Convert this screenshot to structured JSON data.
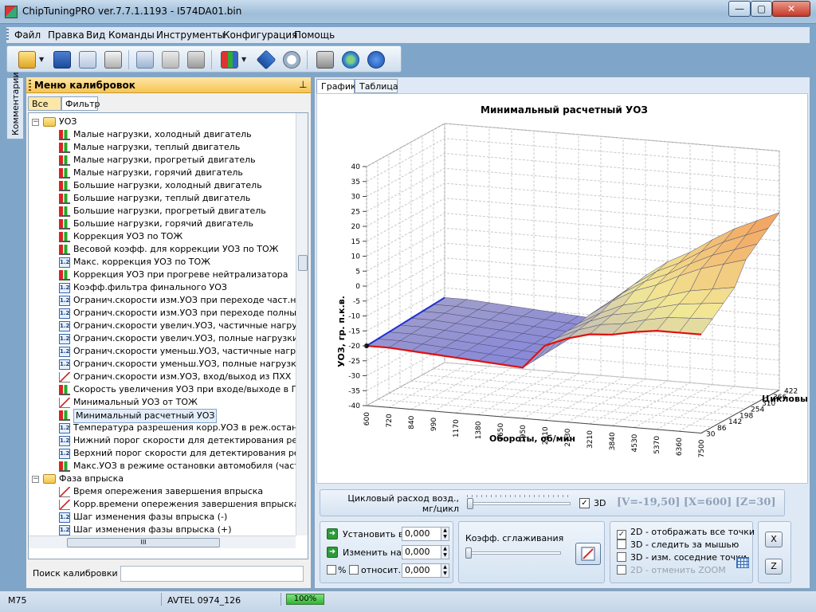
{
  "window": {
    "title": "ChipTuningPRO ver.7.7.1.1193 - I574DA01.bin",
    "buttons": {
      "minimize": "—",
      "maximize": "▢",
      "close": "✕"
    }
  },
  "menu": [
    "Файл",
    "Правка",
    "Вид",
    "Команды",
    "Инструменты",
    "Конфигурация",
    "Помощь"
  ],
  "toolbar": {
    "icons": [
      "open-folder-icon",
      "save-icon",
      "save-as-icon",
      "print-icon",
      "copy-icon",
      "paste-icon",
      "undo-icon",
      "compare-icon",
      "info-icon",
      "checksum-icon",
      "tools-icon",
      "web-update-icon",
      "help-icon"
    ]
  },
  "side_tab": {
    "label": "Комментарии"
  },
  "calibration_panel": {
    "title": "Меню калибровок",
    "pin": "⊥",
    "tabs": [
      "Все",
      "Фильтр"
    ],
    "search_label": "Поиск калибровки",
    "search_value": "",
    "hscroll_grip": "III"
  },
  "tree": [
    {
      "kind": "folder",
      "label": "УОЗ",
      "expander": "−"
    },
    {
      "kind": "chart",
      "label": "Малые нагрузки, холодный двигатель"
    },
    {
      "kind": "chart",
      "label": "Малые нагрузки, теплый двигатель"
    },
    {
      "kind": "chart",
      "label": "Малые нагрузки, прогретый двигатель"
    },
    {
      "kind": "chart",
      "label": "Малые нагрузки, горячий двигатель"
    },
    {
      "kind": "chart",
      "label": "Большие нагрузки, холодный двигатель"
    },
    {
      "kind": "chart",
      "label": "Большие нагрузки, теплый двигатель"
    },
    {
      "kind": "chart",
      "label": "Большие нагрузки, прогретый двигатель"
    },
    {
      "kind": "chart",
      "label": "Большие нагрузки, горячий двигатель"
    },
    {
      "kind": "chart",
      "label": "Коррекция УОЗ по ТОЖ"
    },
    {
      "kind": "chart",
      "label": "Весовой коэфф. для коррекции УОЗ по ТОЖ"
    },
    {
      "kind": "table",
      "label": "Макс. коррекция УОЗ по ТОЖ"
    },
    {
      "kind": "chart",
      "label": "Коррекция УОЗ при прогреве нейтрализатора"
    },
    {
      "kind": "table",
      "label": "Коэфф.фильтра финального УОЗ"
    },
    {
      "kind": "table",
      "label": "Огранич.скорости изм.УОЗ при переходе част.нагруз"
    },
    {
      "kind": "table",
      "label": "Огранич.скорости изм.УОЗ при переходе полные нагр"
    },
    {
      "kind": "table",
      "label": "Огранич.скорости увелич.УОЗ, частичные нагрузки"
    },
    {
      "kind": "table",
      "label": "Огранич.скорости увелич.УОЗ, полные нагрузки"
    },
    {
      "kind": "table",
      "label": "Огранич.скорости уменьш.УОЗ, частичные нагрузки"
    },
    {
      "kind": "table",
      "label": "Огранич.скорости уменьш.УОЗ, полные нагрузки"
    },
    {
      "kind": "curve",
      "label": "Огранич.скорости изм.УОЗ, вход/выход из ПХХ"
    },
    {
      "kind": "chart",
      "label": "Скорость увеличения УОЗ при входе/выходе в ПХХ"
    },
    {
      "kind": "curve",
      "label": "Минимальный УОЗ от ТОЖ"
    },
    {
      "kind": "chart",
      "label": "Минимальный расчетный УОЗ",
      "selected": true
    },
    {
      "kind": "table",
      "label": "Температура разрешения корр.УОЗ в реж.остановки а"
    },
    {
      "kind": "table",
      "label": "Нижний порог скорости для детектирования реж.оста"
    },
    {
      "kind": "table",
      "label": "Верхний порог скорости для детектирования реж.оста"
    },
    {
      "kind": "chart",
      "label": "Макс.УОЗ в режиме остановки автомобиля (част.и по."
    },
    {
      "kind": "folder",
      "label": "Фаза впрыска",
      "expander": "−"
    },
    {
      "kind": "curve",
      "label": "Время опережения завершения впрыска"
    },
    {
      "kind": "curve",
      "label": "Корр.времени опережения завершения впрыска"
    },
    {
      "kind": "table",
      "label": "Шаг изменения фазы впрыска (-)"
    },
    {
      "kind": "table",
      "label": "Шаг изменения фазы впрыска (+)"
    }
  ],
  "view_tabs": [
    "График",
    "Таблица"
  ],
  "chart_data": {
    "type": "surface3d",
    "title": "Минимальный расчетный УОЗ",
    "xlabel": "Обороты, об/мин",
    "ylabel": "УОЗ, гр. п.к.в.",
    "zlabel": "Цикловый р",
    "x_ticks": [
      600,
      720,
      840,
      990,
      1170,
      1380,
      1650,
      1950,
      2310,
      2730,
      3210,
      3840,
      4530,
      5370,
      6360,
      7500
    ],
    "z_ticks": [
      30,
      86,
      142,
      198,
      254,
      310,
      366,
      422
    ],
    "ylim": [
      -40,
      40
    ],
    "y_ticks": [
      40,
      35,
      30,
      25,
      20,
      15,
      10,
      5,
      0,
      -5,
      -10,
      -15,
      -20,
      -25,
      -30,
      -35,
      -40
    ],
    "grid": true,
    "series": [
      {
        "color": "#e01010",
        "values": [
          -20,
          -20,
          -20.5,
          -21,
          -21.5,
          -22,
          -22.5,
          -23,
          -15,
          -12,
          -10,
          -9.5,
          -8,
          -7,
          -7,
          -7
        ]
      }
    ],
    "colors": {
      "surface_flat": "#8a8ad8",
      "surface_high": "#f2c178",
      "highlight_row": "#e01010",
      "first_col": "#2030d0"
    }
  },
  "controls": {
    "slider_label_line1": "Цикловый расход возд.,",
    "slider_label_line2": "мг/цикл",
    "slider1_pos": 0,
    "chk3d_mark": "✓",
    "chk3d_label": "3D",
    "readout": "[V=-19,50] [X=600] [Z=30]",
    "set_label": "Установить в",
    "set_value": "0,000",
    "change_label": "Изменить на",
    "change_value": "0,000",
    "pct_label": "%",
    "relative_label": "относит.",
    "relative_value": "0,000",
    "smoothing_label": "Коэфф. сглаживания",
    "smoothing_pos": 0,
    "options": [
      {
        "label": "2D - отображать все точки",
        "checked": true,
        "disabled": false
      },
      {
        "label": "3D - следить за мышью",
        "checked": false,
        "disabled": false
      },
      {
        "label": "3D - изм. соседние точки",
        "checked": false,
        "disabled": false
      },
      {
        "label": "2D - отменить ZOOM",
        "checked": false,
        "disabled": true
      }
    ],
    "x_button": "X",
    "z_button": "Z",
    "arrow": "➜",
    "spin_up": "▲",
    "spin_down": "▼"
  },
  "status": {
    "mode": "M75",
    "ecu": "AVTEL 0974_126",
    "progress": "100%"
  }
}
